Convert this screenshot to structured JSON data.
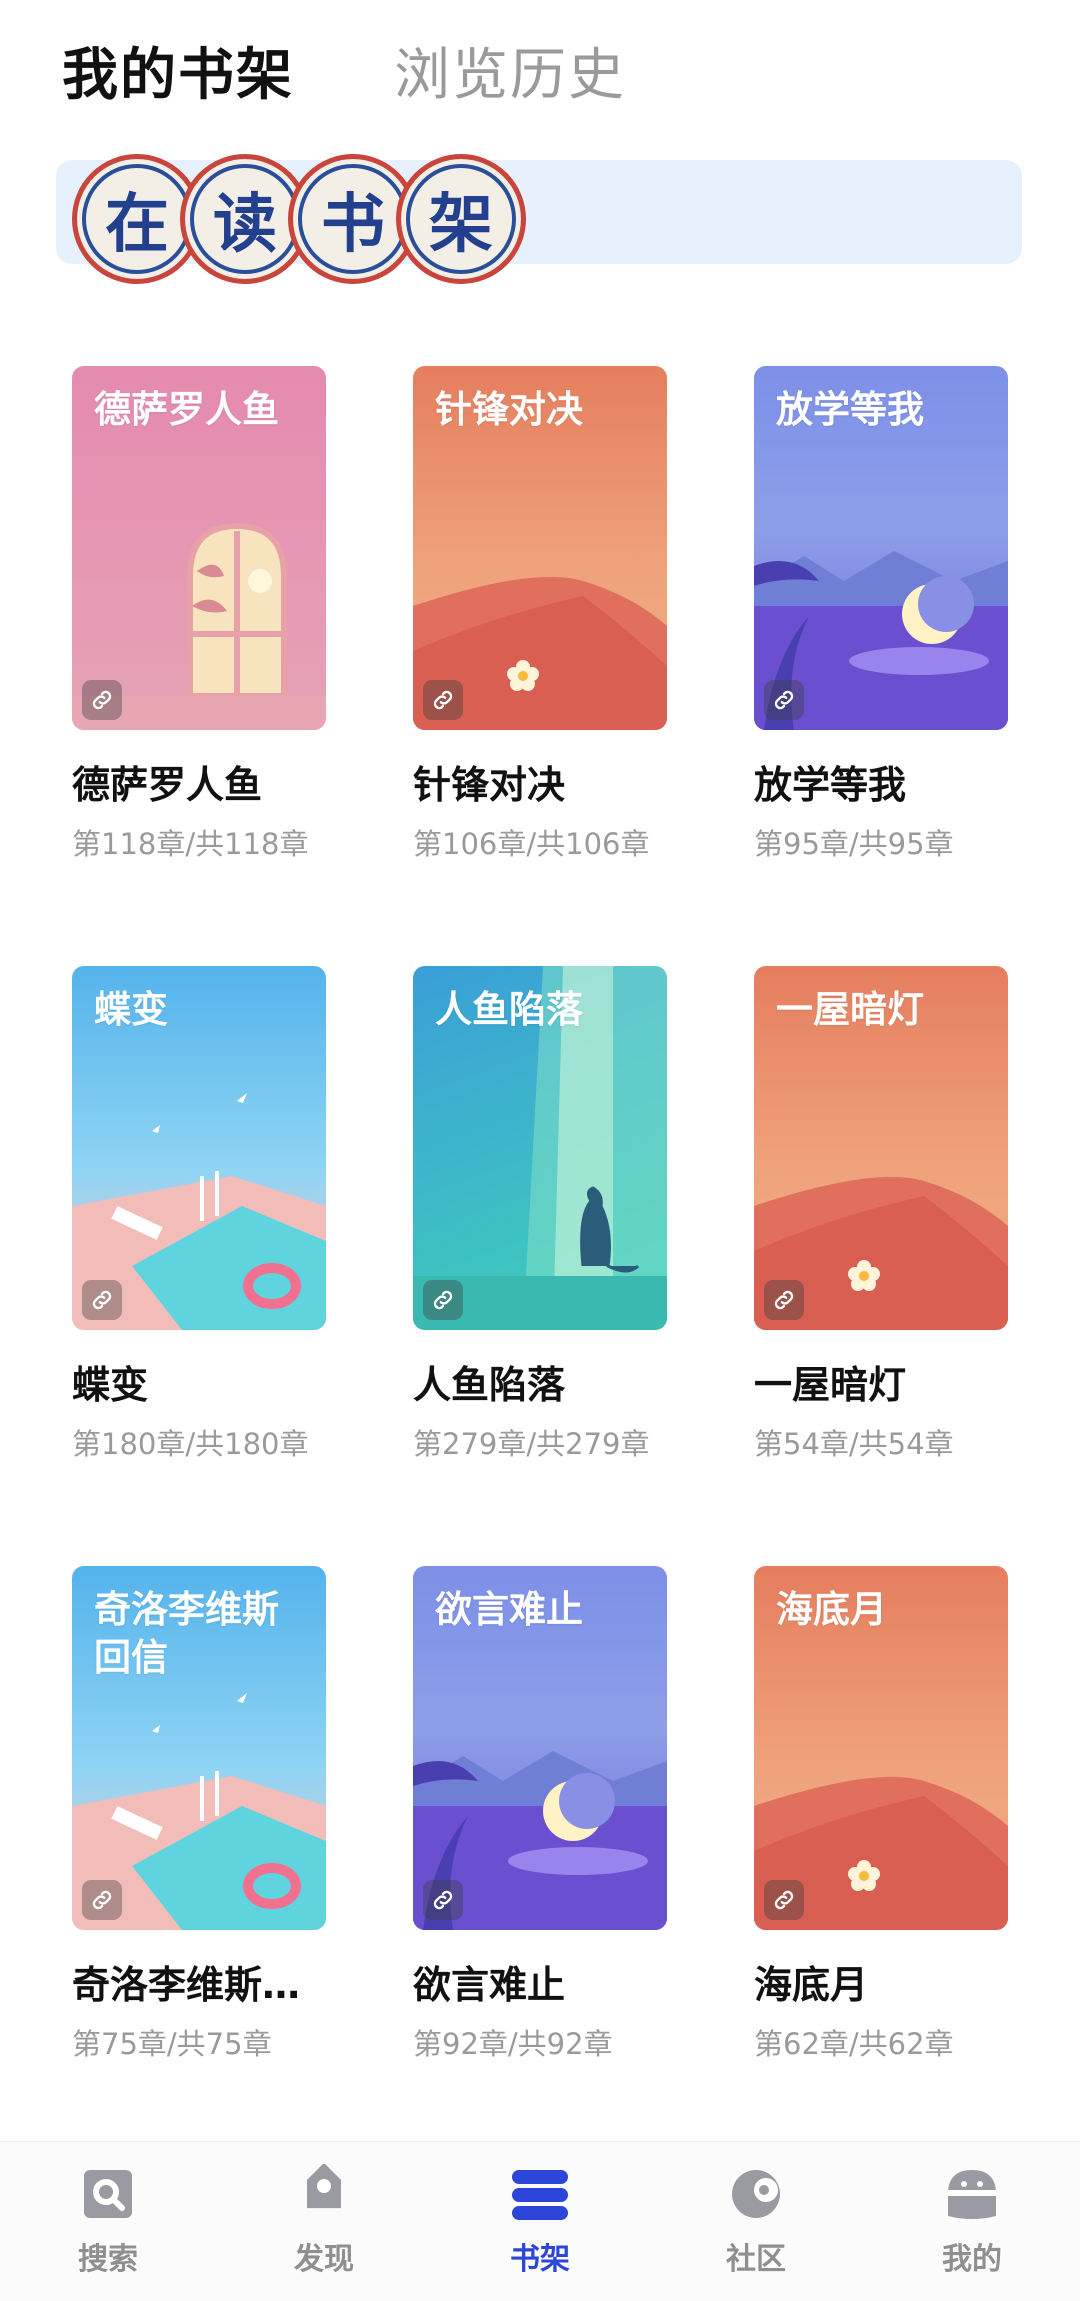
{
  "header": {
    "tabs": [
      {
        "label": "我的书架",
        "active": true
      },
      {
        "label": "浏览历史",
        "active": false
      }
    ]
  },
  "banner": {
    "seal_chars": [
      "在",
      "读",
      "书",
      "架"
    ],
    "colors": {
      "ring": "#c9453b",
      "inner_ring": "#2a4f9a",
      "text": "#23408e",
      "background": "#e6f1fd"
    }
  },
  "books": [
    {
      "cover_title": "德萨罗人鱼",
      "title": "德萨罗人鱼",
      "progress": "第118章/共118章",
      "cover_theme": "pink-window"
    },
    {
      "cover_title": "针锋对决",
      "title": "针锋对决",
      "progress": "第106章/共106章",
      "cover_theme": "desert"
    },
    {
      "cover_title": "放学等我",
      "title": "放学等我",
      "progress": "第95章/共95章",
      "cover_theme": "night-moon"
    },
    {
      "cover_title": "蝶变",
      "title": "蝶变",
      "progress": "第180章/共180章",
      "cover_theme": "pool"
    },
    {
      "cover_title": "人鱼陷落",
      "title": "人鱼陷落",
      "progress": "第279章/共279章",
      "cover_theme": "teal-cat"
    },
    {
      "cover_title": "一屋暗灯",
      "title": "一屋暗灯",
      "progress": "第54章/共54章",
      "cover_theme": "desert"
    },
    {
      "cover_title": "奇洛李维斯回信",
      "title": "奇洛李维斯…",
      "progress": "第75章/共75章",
      "cover_theme": "pool"
    },
    {
      "cover_title": "欲言难止",
      "title": "欲言难止",
      "progress": "第92章/共92章",
      "cover_theme": "night-moon"
    },
    {
      "cover_title": "海底月",
      "title": "海底月",
      "progress": "第62章/共62章",
      "cover_theme": "desert"
    }
  ],
  "bottom_nav": [
    {
      "label": "搜索",
      "icon": "search-icon",
      "active": false
    },
    {
      "label": "发现",
      "icon": "tag-icon",
      "active": false
    },
    {
      "label": "书架",
      "icon": "bookshelf-icon",
      "active": true
    },
    {
      "label": "社区",
      "icon": "community-icon",
      "active": false
    },
    {
      "label": "我的",
      "icon": "profile-icon",
      "active": false
    }
  ],
  "colors": {
    "accent": "#2c46d9",
    "muted": "#9a9a9a"
  }
}
